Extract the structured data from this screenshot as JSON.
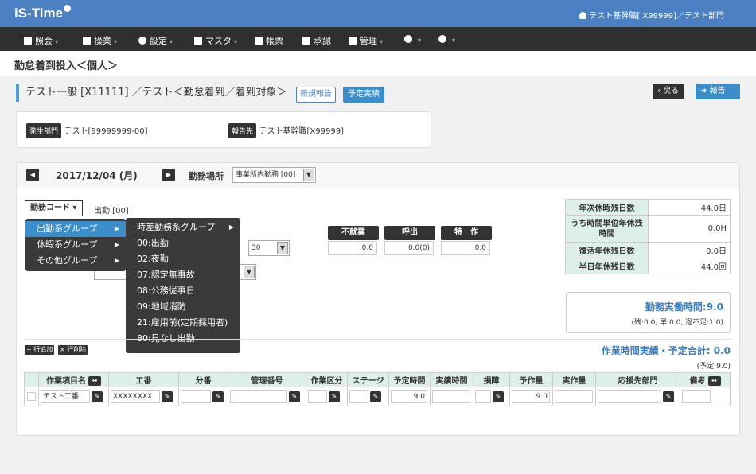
{
  "app": {
    "logo": "iS-Time",
    "user": "テスト基幹職[ X99999]／テスト部門"
  },
  "menu": [
    {
      "label": "照会",
      "icon": "bar-chart-icon",
      "caret": "▾"
    },
    {
      "label": "操業",
      "icon": "monitor-icon",
      "caret": "▾"
    },
    {
      "label": "設定",
      "icon": "gear-icon",
      "caret": "▾"
    },
    {
      "label": "マスタ",
      "icon": "file-icon",
      "caret": "▾"
    },
    {
      "label": "帳票",
      "icon": "print-icon",
      "caret": ""
    },
    {
      "label": "承認",
      "icon": "thumbs-up-icon",
      "caret": ""
    },
    {
      "label": "管理",
      "icon": "grid-icon",
      "caret": "▾"
    },
    {
      "label": "",
      "icon": "chat-icon",
      "caret": "▾"
    },
    {
      "label": "",
      "icon": "help-icon",
      "caret": "▾"
    }
  ],
  "page": {
    "title": "勤怠着到投入＜個人＞",
    "subtitle": "テスト一般 [X11111] ／テスト＜勤怠着到／着到対象＞",
    "btn_new": "新規報告",
    "btn_plan": "予定実績",
    "btn_back": "戻る",
    "btn_report": "報告"
  },
  "info": {
    "dept_label": "発生部門",
    "dept_value": "テスト[99999999-00]",
    "reporter_label": "報告先",
    "reporter_value": "テスト基幹職[X99999]"
  },
  "datebar": {
    "date": "2017/12/04 (月)",
    "workplace_label": "勤務場所",
    "workplace_value": "事業所内勤務 [00]"
  },
  "code": {
    "button": "勤務コード",
    "value": "出勤 [00]"
  },
  "menu1": [
    "出勤系グループ",
    "休暇系グループ",
    "その他グループ"
  ],
  "menu2": [
    "時差勤務系グループ",
    "00:出勤",
    "02:夜勤",
    "07:認定無事故",
    "08:公務従事日",
    "09:地域消防",
    "21:雇用前(定期採用者)",
    "80:見なし出勤"
  ],
  "time_select": "30",
  "stats": [
    {
      "label": "不就業",
      "value": "0.0"
    },
    {
      "label": "呼出",
      "value": "0.0(0)"
    },
    {
      "label": "特　作",
      "value": "0.0"
    }
  ],
  "summary": [
    {
      "label": "年次休暇残日数",
      "value": "44.0日"
    },
    {
      "label": "うち時間単位年休残時間",
      "value": "0.0H"
    },
    {
      "label": "復活年休残日数",
      "value": "0.0日"
    },
    {
      "label": "半日年休残日数",
      "value": "44.0回"
    }
  ],
  "work": {
    "title": "勤務実働時間:",
    "value": "9.0",
    "detail": "(残:0.0, 早:0.0, 過不足:1.0)"
  },
  "grid": {
    "add": "+ 行追加",
    "del": "× 行削除",
    "total_label": "作業時間実績・予定合計:",
    "total_value": "0.0",
    "planned": "(予定:9.0)",
    "headers": [
      "",
      "作業項目名",
      "工番",
      "分番",
      "管理番号",
      "作業区分",
      "ステージ",
      "予定時間",
      "実績時間",
      "損障",
      "予作量",
      "実作量",
      "応援先部門",
      "備考"
    ],
    "row": {
      "item": "テスト工番",
      "koban": "XXXXXXXX",
      "plan": "9.0",
      "yosaku": "9.0"
    }
  }
}
